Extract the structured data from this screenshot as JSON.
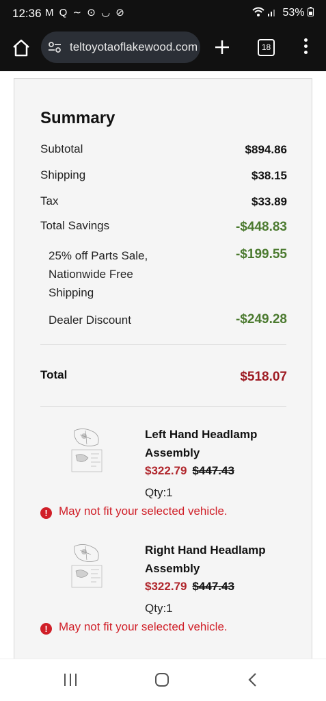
{
  "status_bar": {
    "time": "12:36",
    "icons": [
      "gmail-icon",
      "search-icon",
      "tilde-icon",
      "record-icon",
      "signal-icon",
      "arrow-circle-icon"
    ],
    "icons_text": "M Q ∼ ⊙ ◡ ⊘",
    "wifi": "wifi-icon",
    "signal": "signal-bars-icon",
    "battery_text": "53%",
    "battery_icon": "battery-icon"
  },
  "browser": {
    "url": "teltoyotaoflakewood.com",
    "tab_count": "18"
  },
  "summary": {
    "title": "Summary",
    "rows": [
      {
        "label": "Subtotal",
        "value": "$894.86"
      },
      {
        "label": "Shipping",
        "value": "$38.15"
      },
      {
        "label": "Tax",
        "value": "$33.89"
      },
      {
        "label": "Total Savings",
        "value": "-$448.83"
      }
    ],
    "discounts": [
      {
        "label": "25% off Parts Sale, Nationwide Free Shipping",
        "value": "-$199.55"
      },
      {
        "label": "Dealer Discount",
        "value": "-$249.28"
      }
    ],
    "total_label": "Total",
    "total_value": "$518.07"
  },
  "items": [
    {
      "name": "Left Hand Headlamp Assembly",
      "sale_price": "$322.79",
      "original_price": "$447.43",
      "qty": "Qty:1",
      "warning": "May not fit your selected vehicle."
    },
    {
      "name": "Right Hand Headlamp Assembly",
      "sale_price": "$322.79",
      "original_price": "$447.43",
      "qty": "Qty:1",
      "warning": "May not fit your selected vehicle."
    }
  ],
  "colors": {
    "accent_red": "#b0252b",
    "savings_green": "#4b7a2f",
    "warning_red": "#d01f28"
  }
}
